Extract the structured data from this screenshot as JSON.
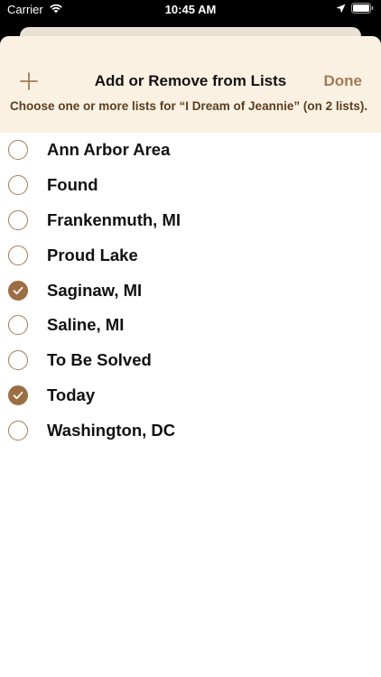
{
  "status_bar": {
    "carrier": "Carrier",
    "time": "10:45 AM",
    "icons": [
      "wifi-icon",
      "location-arrow-icon",
      "battery-icon"
    ]
  },
  "header": {
    "title": "Add or Remove from Lists",
    "done_label": "Done",
    "subtitle": "Choose one or more lists for “I Dream of Jeannie” (on 2 lists).",
    "add_icon": "plus-icon"
  },
  "lists": [
    {
      "label": "Ann Arbor Area",
      "checked": false
    },
    {
      "label": "Found",
      "checked": false
    },
    {
      "label": "Frankenmuth, MI",
      "checked": false
    },
    {
      "label": "Proud Lake",
      "checked": false
    },
    {
      "label": "Saginaw, MI",
      "checked": true
    },
    {
      "label": "Saline, MI",
      "checked": false
    },
    {
      "label": "To Be Solved",
      "checked": false
    },
    {
      "label": "Today",
      "checked": true
    },
    {
      "label": "Washington, DC",
      "checked": false
    }
  ],
  "colors": {
    "accent": "#a37a52",
    "checked_fill": "#9c6e44",
    "header_bg": "#fbf1e2",
    "subtitle_text": "#5a3e22"
  }
}
